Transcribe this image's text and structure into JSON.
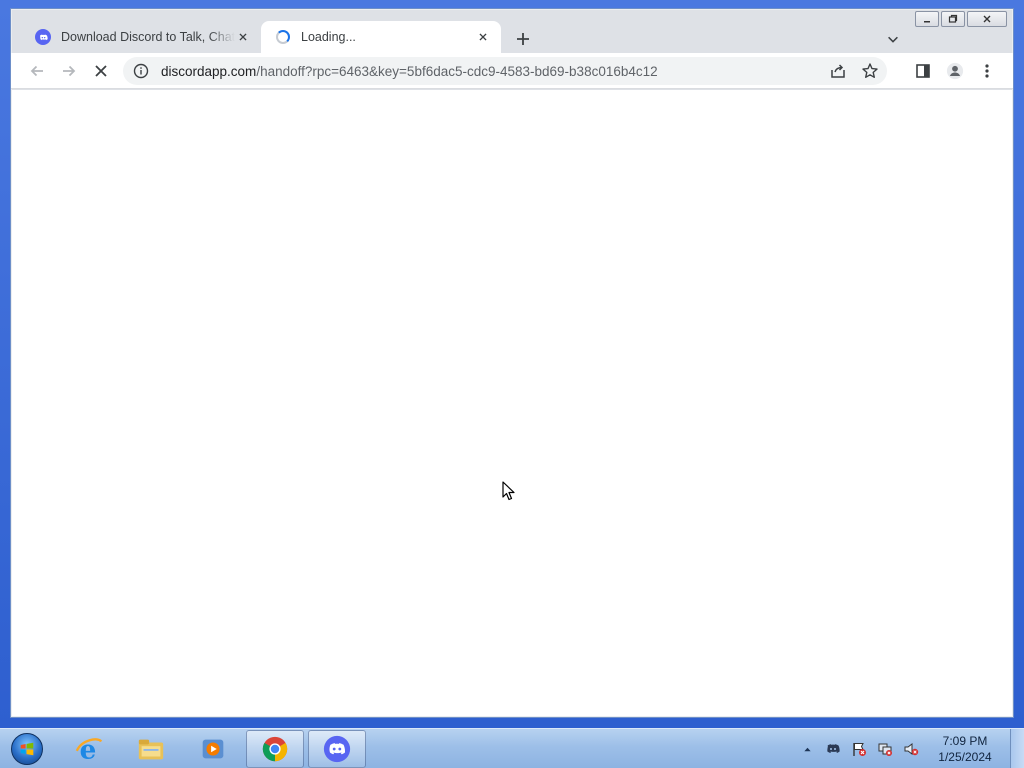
{
  "browser": {
    "tabs": [
      {
        "title": "Download Discord to Talk, Chat, and Hang Out",
        "favicon": "discord-icon",
        "active": false
      },
      {
        "title": "Loading...",
        "favicon": "loading-spinner",
        "active": true
      }
    ],
    "address": {
      "host": "discordapp.com",
      "path": "/handoff?rpc=6463&key=5bf6dac5-cdc9-4583-bd69-b38c016b4c12"
    }
  },
  "taskbar": {
    "apps": [
      {
        "name": "internet-explorer",
        "running": false
      },
      {
        "name": "file-explorer",
        "running": false
      },
      {
        "name": "media-player",
        "running": false
      },
      {
        "name": "chrome",
        "running": true
      },
      {
        "name": "discord",
        "running": true
      }
    ],
    "clock": {
      "time": "7:09 PM",
      "date": "1/25/2024"
    }
  },
  "colors": {
    "discord_blurple": "#5865f2",
    "chrome_tab_bar": "#dee1e6",
    "desktop_blue": "#3d6bd6",
    "taskbar": "#9dbfe8"
  }
}
